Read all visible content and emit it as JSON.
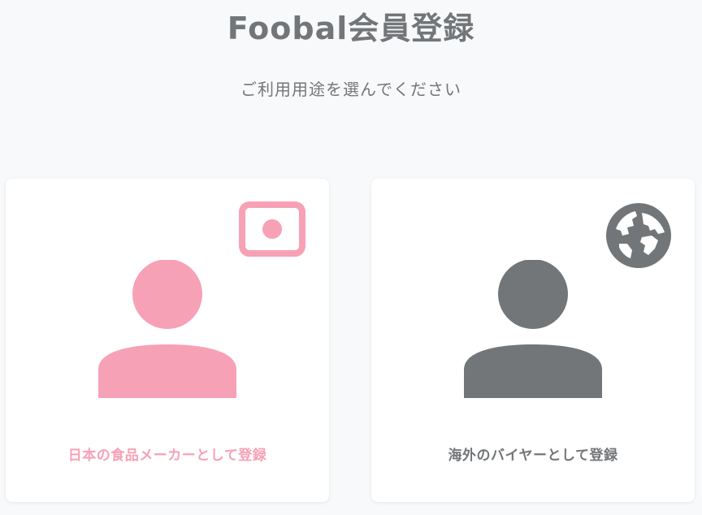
{
  "header": {
    "title": "Foobal会員登録",
    "subtitle": "ご利用用途を選んでください"
  },
  "options": [
    {
      "label": "日本の食品メーカーとして登録",
      "icon": "japan-flag-icon",
      "color": "#f7a1b6"
    },
    {
      "label": "海外のバイヤーとして登録",
      "icon": "globe-icon",
      "color": "#737678"
    }
  ],
  "colors": {
    "background": "#f8f9fb",
    "card": "#ffffff",
    "text": "#737678",
    "accent_pink": "#f7a1b6"
  }
}
